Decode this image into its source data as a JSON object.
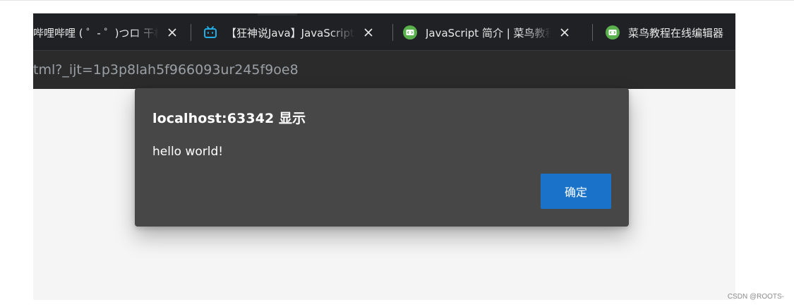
{
  "tabs": [
    {
      "title": "哔哩哔哩 ( ゜- ゜)つロ 干杯~-bilibili",
      "icon": "none"
    },
    {
      "title": "【狂神说Java】JavaScript最新教程",
      "icon": "bilibili-tv-icon"
    },
    {
      "title": "JavaScript 简介 | 菜鸟教程",
      "icon": "runoob-icon"
    },
    {
      "title": "菜鸟教程在线编辑器",
      "icon": "runoob-icon"
    }
  ],
  "address_bar": {
    "url": "tml?_ijt=1p3p8lah5f966093ur245f9oe8"
  },
  "dialog": {
    "title": "localhost:63342 显示",
    "message": "hello world!",
    "ok_label": "确定"
  },
  "watermark": "CSDN @ROOTS-",
  "colors": {
    "tabbar_bg": "#202124",
    "addressbar_bg": "#2b2b2b",
    "dialog_bg": "#474747",
    "ok_button_bg": "#1a73c8",
    "bilibili_blue": "#23ade5",
    "runoob_green": "#5ab04d"
  }
}
